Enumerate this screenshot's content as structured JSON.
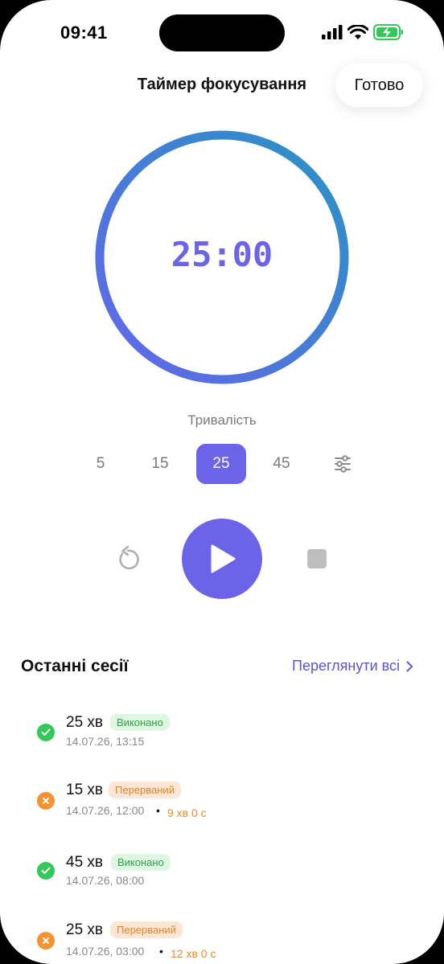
{
  "status": {
    "time": "09:41"
  },
  "header": {
    "title": "Таймер фокусування",
    "done_label": "Готово"
  },
  "timer": {
    "display": "25:00",
    "progress": 1.0
  },
  "duration": {
    "label": "Тривалість",
    "options": [
      "5",
      "15",
      "25",
      "45"
    ],
    "selected": "25"
  },
  "sessions": {
    "title": "Останні сесії",
    "view_all": "Переглянути всі",
    "items": [
      {
        "duration": "25 хв",
        "status": "Виконано",
        "date": "14.07.26, 13:15",
        "elapsed": ""
      },
      {
        "duration": "15 хв",
        "status": "Перерваний",
        "date": "14.07.26, 12:00",
        "elapsed": "9 хв 0 с"
      },
      {
        "duration": "45 хв",
        "status": "Виконано",
        "date": "14.07.26, 08:00",
        "elapsed": ""
      },
      {
        "duration": "25 хв",
        "status": "Перерваний",
        "date": "14.07.26, 03:00",
        "elapsed": "12 хв 0 с"
      }
    ]
  },
  "colors": {
    "accent": "#6b63e8",
    "success": "#34c759",
    "warning": "#f59331"
  }
}
